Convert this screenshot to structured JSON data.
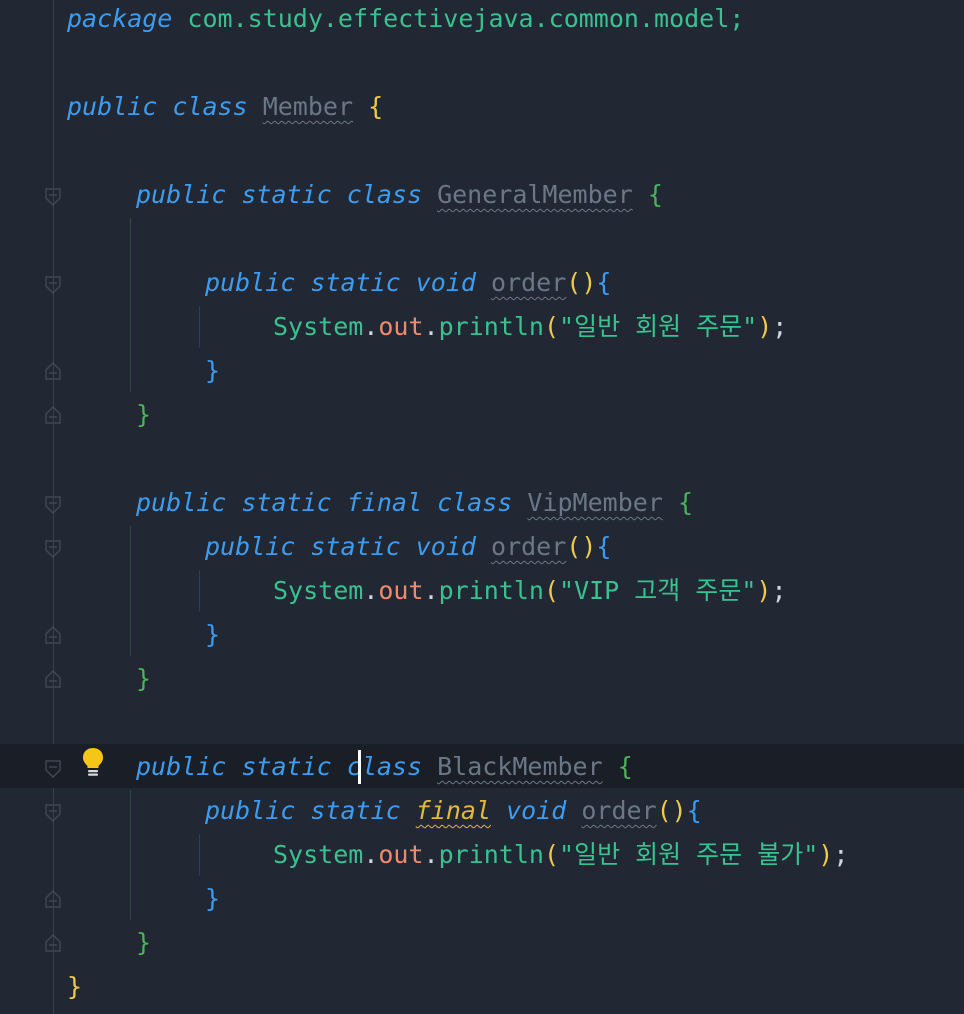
{
  "editor": {
    "language": "java",
    "colors": {
      "background": "#212833",
      "keyword": "#3d9cf0",
      "string": "#39c290",
      "field": "#f08a6c",
      "unused": "#6b7787",
      "warning": "#e3b93c"
    },
    "lines": {
      "l1": {
        "kw": "package",
        "pkg": "com.study.effectivejava.common.model;"
      },
      "l3": {
        "kw1": "public",
        "kw2": "class",
        "name": "Member",
        "brace": "{"
      },
      "l5": {
        "kw1": "public",
        "kw2": "static",
        "kw3": "class",
        "name": "GeneralMember",
        "brace": "{"
      },
      "l7": {
        "kw1": "public",
        "kw2": "static",
        "kw3": "void",
        "name": "order",
        "paren": "()",
        "brace": "{"
      },
      "l8": {
        "sys": "System",
        "dot1": ".",
        "field": "out",
        "dot2": ".",
        "call": "println",
        "open": "(",
        "str": "\"일반 회원 주문\"",
        "close": ")",
        "semi": ";"
      },
      "l9": {
        "brace": "}"
      },
      "l10": {
        "brace": "}"
      },
      "l12": {
        "kw1": "public",
        "kw2": "static",
        "kw3": "final",
        "kw4": "class",
        "name": "VipMember",
        "brace": "{"
      },
      "l13": {
        "kw1": "public",
        "kw2": "static",
        "kw3": "void",
        "name": "order",
        "paren": "()",
        "brace": "{"
      },
      "l14": {
        "sys": "System",
        "dot1": ".",
        "field": "out",
        "dot2": ".",
        "call": "println",
        "open": "(",
        "str": "\"VIP 고객 주문\"",
        "close": ")",
        "semi": ";"
      },
      "l15": {
        "brace": "}"
      },
      "l16": {
        "brace": "}"
      },
      "l18": {
        "kw1": "public",
        "kw2a": "stati",
        "kw2b": "c",
        "kw3": "class",
        "name": "BlackMember",
        "brace": "{"
      },
      "l19": {
        "kw1": "public",
        "kw2": "static",
        "kw3": "final",
        "kw4": "void",
        "name": "order",
        "paren": "()",
        "brace": "{"
      },
      "l20": {
        "sys": "System",
        "dot1": ".",
        "field": "out",
        "dot2": ".",
        "call": "println",
        "open": "(",
        "str": "\"일반 회원 주문 불가\"",
        "close": ")",
        "semi": ";"
      },
      "l21": {
        "brace": "}"
      },
      "l22": {
        "brace": "}"
      },
      "l23": {
        "brace": "}"
      }
    },
    "gutter": {
      "intention_icon": "lightbulb-icon"
    }
  }
}
